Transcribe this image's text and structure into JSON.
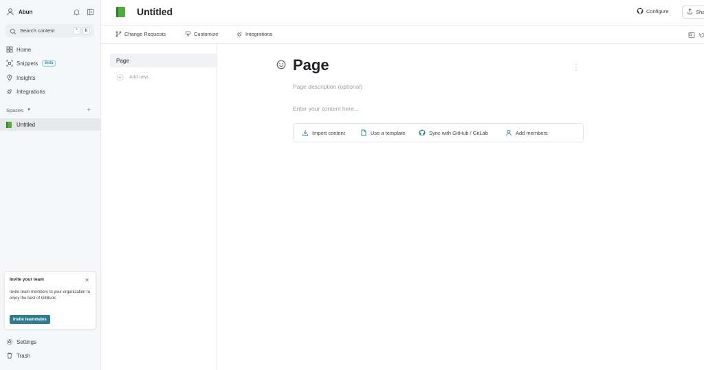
{
  "user": {
    "name": "Abun"
  },
  "search": {
    "placeholder": "Search content",
    "shortcut": [
      "⌃",
      "K"
    ]
  },
  "nav": [
    {
      "label": "Home",
      "icon": "home-icon"
    },
    {
      "label": "Snippets",
      "icon": "snippets-icon",
      "badge": "Beta"
    },
    {
      "label": "Insights",
      "icon": "insights-icon"
    },
    {
      "label": "Integrations",
      "icon": "integrations-icon"
    }
  ],
  "spaces": {
    "header": "Spaces",
    "items": [
      {
        "label": "Untitled"
      }
    ]
  },
  "invite": {
    "title": "Invite your team",
    "description": "Invite team members to your organization to enjoy the best of GitBook.",
    "button": "Invite teammates"
  },
  "bottom_nav": [
    {
      "label": "Settings",
      "icon": "gear-icon"
    },
    {
      "label": "Trash",
      "icon": "trash-icon"
    }
  ],
  "header": {
    "title": "Untitled",
    "configure": "Configure",
    "share": "Share"
  },
  "toolbar": {
    "change_requests": "Change Requests",
    "customize": "Customize",
    "integrations": "Integrations"
  },
  "tree": {
    "items": [
      {
        "label": "Page"
      }
    ],
    "add_new": "Add new..."
  },
  "editor": {
    "title": "Page",
    "description_placeholder": "Page description (optional)",
    "content_placeholder": "Enter your content here...",
    "actions": [
      {
        "label": "Import content",
        "icon": "download-icon"
      },
      {
        "label": "Use a template",
        "icon": "document-icon"
      },
      {
        "label": "Sync with GitHub / GitLab",
        "icon": "github-icon"
      },
      {
        "label": "Add members",
        "icon": "user-icon"
      }
    ]
  },
  "colors": {
    "accent": "#2d7d8f",
    "book_green": "#4caf3a"
  }
}
